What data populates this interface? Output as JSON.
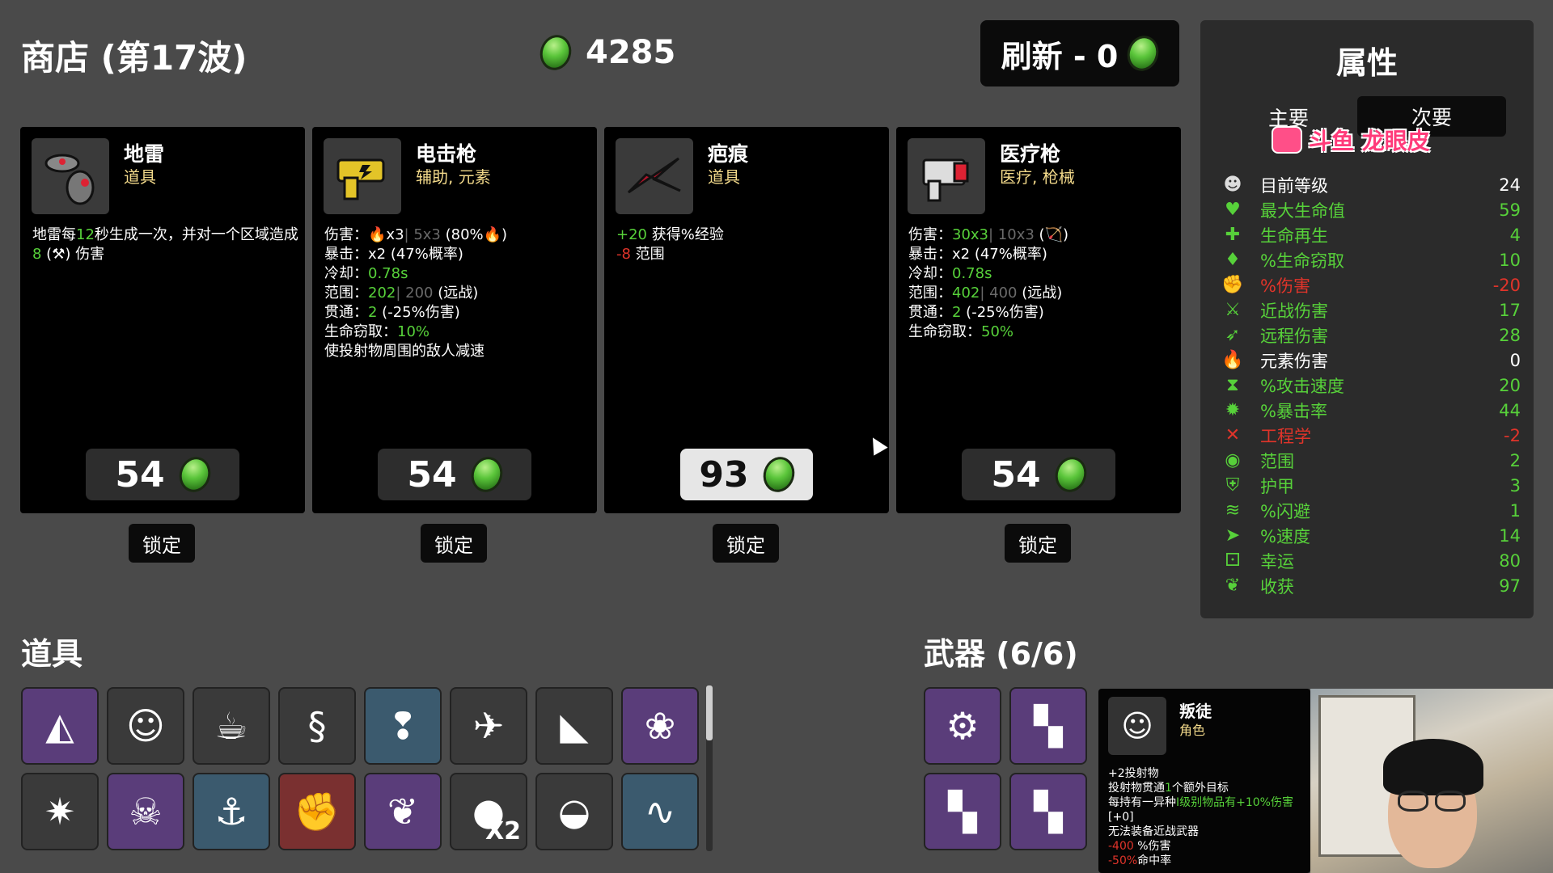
{
  "header": {
    "title": "商店 (第17波)",
    "gold": "4285",
    "refresh_label": "刷新 - 0"
  },
  "shop": [
    {
      "name": "地雷",
      "type": "道具",
      "icon": "landmine-icon",
      "price": "54",
      "lock": "锁定",
      "desc": [
        "地雷每",
        "12",
        "秒生成一次，并对一个区域造成",
        "8",
        " (",
        "⚒",
        ") 伤害"
      ]
    },
    {
      "name": "电击枪",
      "type": "辅助, 元素",
      "icon": "taser-icon",
      "price": "54",
      "lock": "锁定",
      "lines": [
        {
          "label": "伤害：",
          "value": "🔥x3",
          "extra": "| 5x3",
          "tail": " (80%🔥)"
        },
        {
          "label": "暴击：",
          "value": "x2",
          "tail": " (47%概率)"
        },
        {
          "label": "冷却：",
          "value": "0.78s",
          "tail": ""
        },
        {
          "label": "范围：",
          "value": "202",
          "extra": "| 200",
          "tail": " (远战)"
        },
        {
          "label": "贯通：",
          "value": "2",
          "tail": " (-25%伤害)"
        },
        {
          "label": "生命窃取：",
          "value": "10%",
          "tail": ""
        }
      ],
      "note": "使投射物周围的敌人减速"
    },
    {
      "name": "疤痕",
      "type": "道具",
      "icon": "scar-icon",
      "price": "93",
      "lock": "锁定",
      "effects": [
        {
          "value": "+20",
          "text": " 获得%经验",
          "color": "green"
        },
        {
          "value": "-8",
          "text": " 范围",
          "color": "red"
        }
      ]
    },
    {
      "name": "医疗枪",
      "type": "医疗, 枪械",
      "icon": "medical-gun-icon",
      "price": "54",
      "lock": "锁定",
      "lines": [
        {
          "label": "伤害：",
          "value": "30x3",
          "extra": "| 10x3",
          "tail": " (🏹)"
        },
        {
          "label": "暴击：",
          "value": "x2",
          "tail": " (47%概率)"
        },
        {
          "label": "冷却：",
          "value": "0.78s",
          "tail": ""
        },
        {
          "label": "范围：",
          "value": "402",
          "extra": "| 400",
          "tail": " (远战)"
        },
        {
          "label": "贯通：",
          "value": "2",
          "tail": " (-25%伤害)"
        },
        {
          "label": "生命窃取：",
          "value": "50%",
          "tail": ""
        }
      ]
    }
  ],
  "stats": {
    "title": "属性",
    "tab_main": "主要",
    "tab_secondary": "次要",
    "watermark": "斗鱼 龙眼皮",
    "rows": [
      {
        "name": "目前等级",
        "value": "24",
        "color": "#ffffff",
        "icon": "level-icon",
        "glyph": "☻"
      },
      {
        "name": "最大生命值",
        "value": "59",
        "color": "#57d13a",
        "icon": "heart-icon",
        "glyph": "♥"
      },
      {
        "name": "生命再生",
        "value": "4",
        "color": "#57d13a",
        "icon": "regen-icon",
        "glyph": "✚"
      },
      {
        "name": "%生命窃取",
        "value": "10",
        "color": "#57d13a",
        "icon": "lifesteal-icon",
        "glyph": "♦"
      },
      {
        "name": "%伤害",
        "value": "-20",
        "color": "#e0342a",
        "icon": "damage-icon",
        "glyph": "✊"
      },
      {
        "name": "近战伤害",
        "value": "17",
        "color": "#57d13a",
        "icon": "melee-icon",
        "glyph": "⚔"
      },
      {
        "name": "远程伤害",
        "value": "28",
        "color": "#57d13a",
        "icon": "ranged-icon",
        "glyph": "➶"
      },
      {
        "name": "元素伤害",
        "value": "0",
        "color": "#ffffff",
        "icon": "elemental-icon",
        "glyph": "🔥"
      },
      {
        "name": "%攻击速度",
        "value": "20",
        "color": "#57d13a",
        "icon": "attack-speed-icon",
        "glyph": "⧗"
      },
      {
        "name": "%暴击率",
        "value": "44",
        "color": "#57d13a",
        "icon": "crit-icon",
        "glyph": "✹"
      },
      {
        "name": "工程学",
        "value": "-2",
        "color": "#e0342a",
        "icon": "engineering-icon",
        "glyph": "✕"
      },
      {
        "name": "范围",
        "value": "2",
        "color": "#57d13a",
        "icon": "range-icon",
        "glyph": "◉"
      },
      {
        "name": "护甲",
        "value": "3",
        "color": "#57d13a",
        "icon": "armor-icon",
        "glyph": "⛨"
      },
      {
        "name": "%闪避",
        "value": "1",
        "color": "#57d13a",
        "icon": "dodge-icon",
        "glyph": "≋"
      },
      {
        "name": "%速度",
        "value": "14",
        "color": "#57d13a",
        "icon": "speed-icon",
        "glyph": "➤"
      },
      {
        "name": "幸运",
        "value": "80",
        "color": "#57d13a",
        "icon": "luck-icon",
        "glyph": "⚀"
      },
      {
        "name": "收获",
        "value": "97",
        "color": "#57d13a",
        "icon": "harvest-icon",
        "glyph": "❦"
      }
    ]
  },
  "items_section": {
    "title": "道具",
    "slots": [
      {
        "icon": "triangle-prism-icon",
        "glyph": "◭",
        "style": "s-purple"
      },
      {
        "icon": "mask-icon",
        "glyph": "☺",
        "style": "s-dark"
      },
      {
        "icon": "coffee-cup-icon",
        "glyph": "☕",
        "style": "s-dark"
      },
      {
        "icon": "tentacle-icon",
        "glyph": "§",
        "style": "s-dark"
      },
      {
        "icon": "alien-rock-icon",
        "glyph": "❢",
        "style": "s-blue"
      },
      {
        "icon": "rocket-icon",
        "glyph": "✈",
        "style": "s-dark"
      },
      {
        "icon": "bat-icon",
        "glyph": "◣",
        "style": "s-dark"
      },
      {
        "icon": "peacock-icon",
        "glyph": "❀",
        "style": "s-purple"
      },
      {
        "icon": "dynamite-icon",
        "glyph": "✷",
        "style": "s-dark"
      },
      {
        "icon": "monkey-icon",
        "glyph": "☠",
        "style": "s-purple"
      },
      {
        "icon": "hook-icon",
        "glyph": "⚓",
        "style": "s-blue"
      },
      {
        "icon": "muscle-icon",
        "glyph": "✊",
        "style": "s-red"
      },
      {
        "icon": "wheat-icon",
        "glyph": "❦",
        "style": "s-purple"
      },
      {
        "icon": "bubble-icon",
        "glyph": "●",
        "style": "s-dark",
        "count": "X2"
      },
      {
        "icon": "creature-icon",
        "glyph": "◒",
        "style": "s-dark"
      },
      {
        "icon": "tentacle-arm-icon",
        "glyph": "∿",
        "style": "s-blue"
      }
    ]
  },
  "weapons_section": {
    "title": "武器 (6/6)",
    "slots": [
      {
        "icon": "minigun-icon",
        "glyph": "⚙"
      },
      {
        "icon": "medical-gun-icon",
        "glyph": "▚"
      },
      {
        "icon": "medical-gun-icon",
        "glyph": "▚"
      },
      {
        "icon": "medical-gun-icon",
        "glyph": "▚"
      }
    ]
  },
  "tooltip": {
    "name": "叛徒",
    "type": "角色",
    "lines": [
      {
        "text": "+2投射物",
        "color": "#ffffff"
      },
      {
        "text": "投射物贯通",
        "color": "#ffffff",
        "hl": "1",
        "rest": "个额外目标"
      },
      {
        "text": "每持有一异种",
        "color": "#ffffff",
        "hl": "I级别物品有+10%伤害",
        "rest": ""
      },
      {
        "text": "[+0]",
        "color": "#ffffff"
      },
      {
        "text": "无法装备近战武器",
        "color": "#ffffff"
      },
      {
        "text": "-400",
        "color": "#e0342a",
        "rest": " %伤害"
      },
      {
        "text": "-50%",
        "color": "#e0342a",
        "rest": "命中率"
      }
    ]
  }
}
